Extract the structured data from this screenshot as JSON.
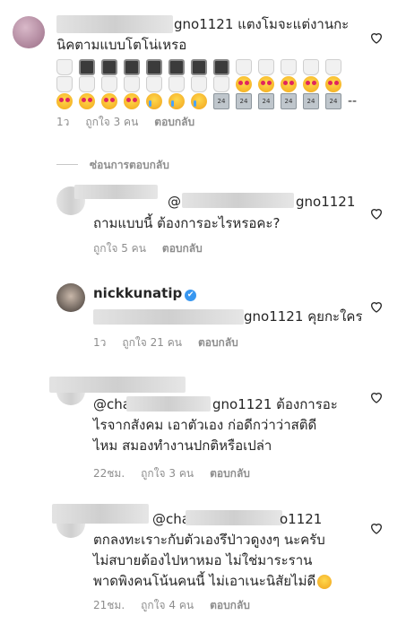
{
  "comments": [
    {
      "text_suffix": "gno1121 แตงโมจะแต่งานกะ",
      "line2": "นิคตามแบบโตโน่เหรอ",
      "time": "1ว",
      "likes": "ถูกใจ 3 คน",
      "reply": "ตอบกลับ",
      "emoji_row1": [
        "toilet",
        "tv",
        "tv",
        "tv",
        "tv",
        "tv",
        "tv",
        "tv",
        "toilet",
        "toilet",
        "toilet",
        "toilet",
        "toilet"
      ],
      "emoji_row2": [
        "toilet",
        "toilet",
        "toilet",
        "toilet",
        "toilet",
        "toilet",
        "toilet",
        "toilet",
        "heart-eyes",
        "heart-eyes",
        "heart-eyes",
        "heart-eyes",
        "heart-eyes"
      ],
      "emoji_row3": [
        "heart-eyes",
        "heart-eyes",
        "heart-eyes",
        "heart-eyes",
        "cry",
        "cry",
        "cry",
        "trophy",
        "trophy",
        "trophy",
        "trophy",
        "trophy",
        "trophy"
      ],
      "emoji_row3_suffix": "--"
    },
    {
      "mention_prefix": "@",
      "mention_suffix": "gno1121",
      "text": "ถามแบบนี้ ต้องการอะไรหรอคะ?",
      "likes": "ถูกใจ 5 คน",
      "reply": "ตอบกลับ"
    },
    {
      "username": "nickkunatip",
      "verified_mark": "✔",
      "mention_suffix": "gno1121 คุยกะใคร",
      "time": "1ว",
      "likes": "ถูกใจ 21 คน",
      "reply": "ตอบกลับ"
    },
    {
      "mention_prefix": "@cha",
      "mention_suffix": "gno1121 ต้องการอะ",
      "line2": "ไรจากสังคม เอาตัวเอง ก่อดีกว่าว่าสติดี",
      "line3": "ไหม สมองทำงานปกติหรือเปล่า",
      "time": "22ชม.",
      "likes": "ถูกใจ 3 คน",
      "reply": "ตอบกลับ"
    },
    {
      "mention_prefix": "@cha",
      "mention_suffix": "o1121",
      "line2": "ตกลงทะเราะกับตัวเองรึป่าวดูงงๆ นะครับ",
      "line3": "ไม่สบายต้องไปหาหมอ ไม่ใช่มาระราน",
      "line4": "พาดพิงคนโน้นคนนี้ ไม่เอาเนะนิสัยไม่ดี",
      "time": "21ชม.",
      "likes": "ถูกใจ 4 คน",
      "reply": "ตอบกลับ"
    }
  ],
  "hide_replies": "ซ่อนการตอบกลับ",
  "icons": {
    "like": "heart-outline-icon"
  },
  "colors": {
    "text": "#262626",
    "meta": "#8e8e8e",
    "verified": "#3897f0"
  }
}
